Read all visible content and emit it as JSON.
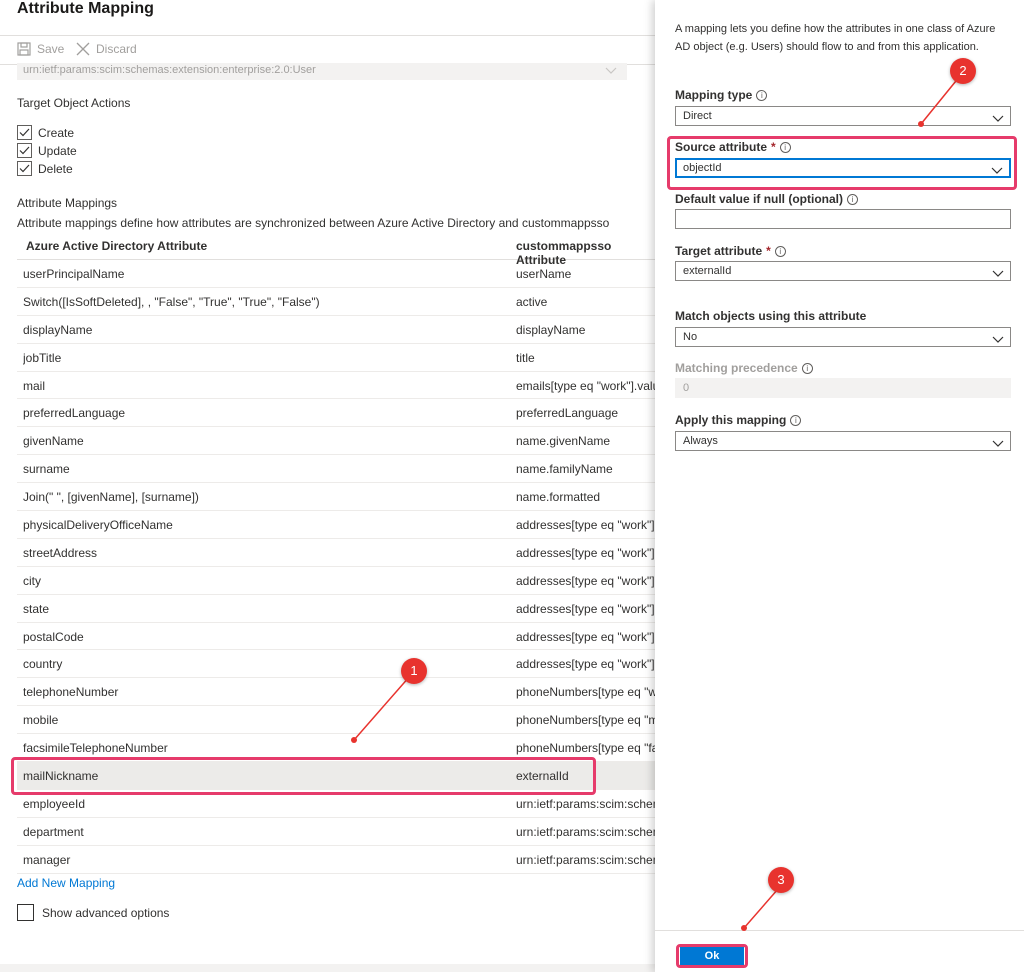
{
  "header": {
    "title": "Attribute Mapping"
  },
  "toolbar": {
    "save_label": "Save",
    "discard_label": "Discard"
  },
  "schema": {
    "value": "urn:ietf:params:scim:schemas:extension:enterprise:2.0:User"
  },
  "target_actions": {
    "title": "Target Object Actions",
    "items": [
      {
        "label": "Create",
        "checked": true
      },
      {
        "label": "Update",
        "checked": true
      },
      {
        "label": "Delete",
        "checked": true
      }
    ]
  },
  "mappings": {
    "title": "Attribute Mappings",
    "description": "Attribute mappings define how attributes are synchronized between Azure Active Directory and custommappsso",
    "col_source": "Azure Active Directory Attribute",
    "col_target": "custommappsso Attribute",
    "rows": [
      [
        "userPrincipalName",
        "userName"
      ],
      [
        "Switch([IsSoftDeleted], , \"False\", \"True\", \"True\", \"False\")",
        "active"
      ],
      [
        "displayName",
        "displayName"
      ],
      [
        "jobTitle",
        "title"
      ],
      [
        "mail",
        "emails[type eq \"work\"].valu"
      ],
      [
        "preferredLanguage",
        "preferredLanguage"
      ],
      [
        "givenName",
        "name.givenName"
      ],
      [
        "surname",
        "name.familyName"
      ],
      [
        "Join(\" \", [givenName], [surname])",
        "name.formatted"
      ],
      [
        "physicalDeliveryOfficeName",
        "addresses[type eq \"work\"].f"
      ],
      [
        "streetAddress",
        "addresses[type eq \"work\"]."
      ],
      [
        "city",
        "addresses[type eq \"work\"]."
      ],
      [
        "state",
        "addresses[type eq \"work\"]."
      ],
      [
        "postalCode",
        "addresses[type eq \"work\"]."
      ],
      [
        "country",
        "addresses[type eq \"work\"]."
      ],
      [
        "telephoneNumber",
        "phoneNumbers[type eq \"w"
      ],
      [
        "mobile",
        "phoneNumbers[type eq \"m"
      ],
      [
        "facsimileTelephoneNumber",
        "phoneNumbers[type eq \"fa"
      ],
      [
        "mailNickname",
        "externalId"
      ],
      [
        "employeeId",
        "urn:ietf:params:scim:schema"
      ],
      [
        "department",
        "urn:ietf:params:scim:schema"
      ],
      [
        "manager",
        "urn:ietf:params:scim:schema"
      ]
    ],
    "selected_row": "mailNickname",
    "add_label": "Add New Mapping",
    "advanced_label": "Show advanced options"
  },
  "panel": {
    "intro": "A mapping lets you define how the attributes in one class of Azure AD object (e.g. Users) should flow to and from this application.",
    "mapping_type_label": "Mapping type",
    "mapping_type_value": "Direct",
    "source_label": "Source attribute",
    "source_value": "objectId",
    "default_label": "Default value if null (optional)",
    "default_value": "",
    "target_label": "Target attribute",
    "target_value": "externalId",
    "match_label": "Match objects using this attribute",
    "match_value": "No",
    "precedence_label": "Matching precedence",
    "precedence_value": "0",
    "apply_label": "Apply this mapping",
    "apply_value": "Always",
    "required_mark": "*",
    "info_glyph": "i",
    "ok_label": "Ok"
  },
  "annotations": {
    "badge_1": "1",
    "badge_2": "2",
    "badge_3": "3",
    "color": "#e63b6b"
  }
}
